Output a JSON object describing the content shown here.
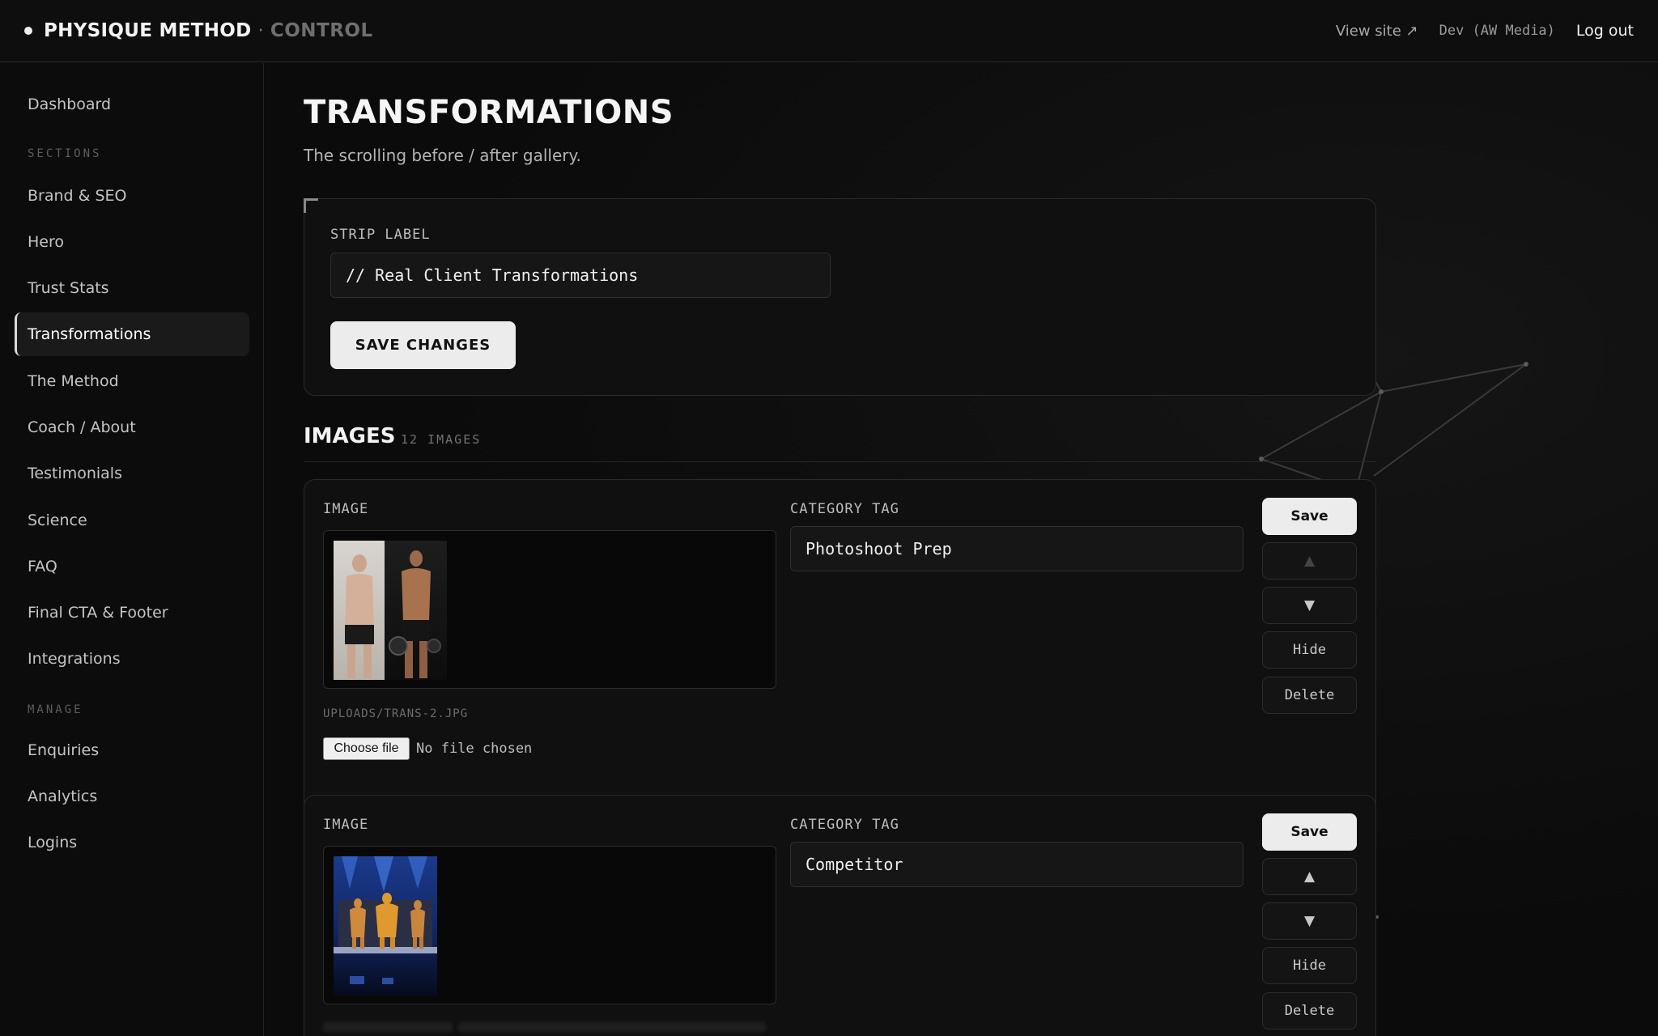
{
  "topbar": {
    "brand_name": "PHYSIQUE METHOD",
    "brand_sep": "·",
    "brand_sub": "CONTROL",
    "view_site": "View site ↗",
    "dev_label": "Dev (AW Media)",
    "logout": "Log out"
  },
  "sidebar": {
    "dashboard": "Dashboard",
    "sections_heading": "SECTIONS",
    "sections": [
      "Brand & SEO",
      "Hero",
      "Trust Stats",
      "Transformations",
      "The Method",
      "Coach / About",
      "Testimonials",
      "Science",
      "FAQ",
      "Final CTA & Footer",
      "Integrations"
    ],
    "manage_heading": "MANAGE",
    "manage": [
      "Enquiries",
      "Analytics",
      "Logins"
    ],
    "active": "Transformations"
  },
  "page": {
    "title": "TRANSFORMATIONS",
    "subtitle": "The scrolling before / after gallery."
  },
  "strip": {
    "label": "STRIP LABEL",
    "value": "// Real Client Transformations",
    "save": "SAVE CHANGES"
  },
  "images": {
    "title": "IMAGES",
    "count": "12 IMAGES",
    "items": [
      {
        "image_label": "IMAGE",
        "tag_label": "CATEGORY TAG",
        "tag": "Photoshoot Prep",
        "path": "UPLOADS/TRANS-2.JPG",
        "choose_file": "Choose file",
        "file_status": "No file chosen",
        "save": "Save",
        "up": "▲",
        "down": "▼",
        "hide": "Hide",
        "delete": "Delete"
      },
      {
        "image_label": "IMAGE",
        "tag_label": "CATEGORY TAG",
        "tag": "Competitor",
        "save": "Save",
        "up": "▲",
        "down": "▼",
        "hide": "Hide",
        "delete": "Delete"
      }
    ]
  }
}
